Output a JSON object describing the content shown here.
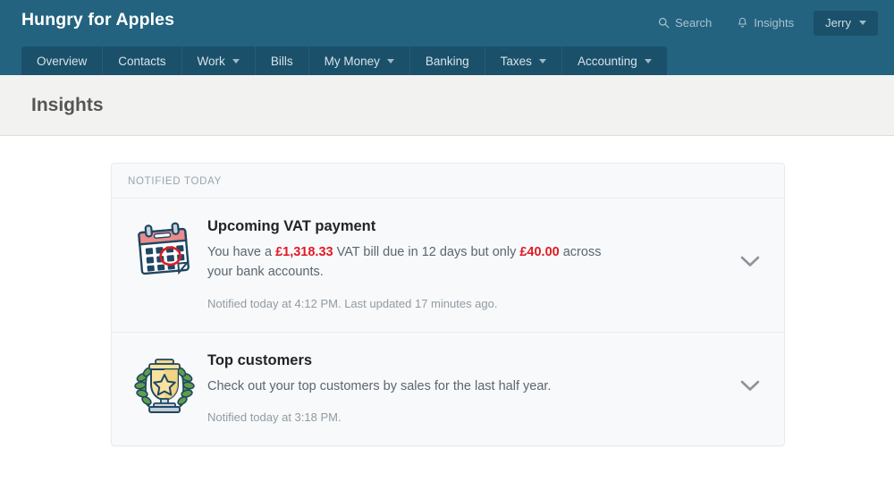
{
  "header": {
    "brand": "Hungry for Apples",
    "search_label": "Search",
    "insights_label": "Insights",
    "user_label": "Jerry",
    "bg_color": "#23637f",
    "nav_bg_color": "#1b506a"
  },
  "nav": {
    "items": [
      {
        "label": "Overview",
        "has_caret": false
      },
      {
        "label": "Contacts",
        "has_caret": false
      },
      {
        "label": "Work",
        "has_caret": true
      },
      {
        "label": "Bills",
        "has_caret": false
      },
      {
        "label": "My Money",
        "has_caret": true
      },
      {
        "label": "Banking",
        "has_caret": false
      },
      {
        "label": "Taxes",
        "has_caret": true
      },
      {
        "label": "Accounting",
        "has_caret": true
      }
    ]
  },
  "page": {
    "title": "Insights"
  },
  "card": {
    "section_label": "NOTIFIED TODAY",
    "insights": [
      {
        "icon": "calendar-icon",
        "title": "Upcoming VAT payment",
        "desc_part1": "You have a ",
        "amount1": "£1,318.33",
        "desc_part2": " VAT bill due in 12 days but only ",
        "amount2": "£40.00",
        "desc_part3": " across your bank accounts.",
        "meta": "Notified today at 4:12 PM. Last updated 17 minutes ago.",
        "amount_color": "#e01a24"
      },
      {
        "icon": "trophy-icon",
        "title": "Top customers",
        "desc_full": "Check out your top customers by sales for the last half year.",
        "meta": "Notified today at 3:18 PM."
      }
    ]
  }
}
